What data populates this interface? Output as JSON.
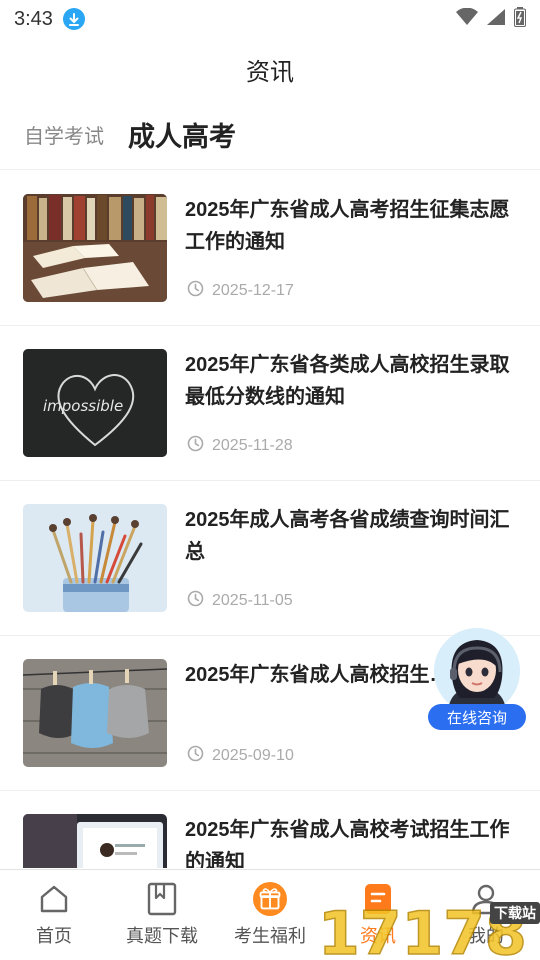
{
  "status": {
    "time": "3:43"
  },
  "header": {
    "title": "资讯"
  },
  "tabs": [
    {
      "label": "自学考试"
    },
    {
      "label": "成人高考"
    }
  ],
  "news": [
    {
      "title": "2025年广东省成人高考招生征集志愿工作的通知",
      "date": "2025-12-17",
      "image": "books-on-table"
    },
    {
      "title": "2025年广东省各类成人高校招生录取最低分数线的通知",
      "date": "2025-11-28",
      "image": "chalkboard-heart-impossible"
    },
    {
      "title": "2025年成人高考各省成绩查询时间汇总",
      "date": "2025-11-05",
      "image": "paint-brushes-in-jar"
    },
    {
      "title": "2025年广东省成人高校招生…布",
      "date": "2025-09-10",
      "image": "masks-on-clothesline"
    },
    {
      "title": "2025年广东省成人高校考试招生工作的通知",
      "date": "",
      "image": "laptop-on-desk"
    }
  ],
  "float": {
    "label": "在线咨询"
  },
  "nav": [
    {
      "label": "首页",
      "icon": "home-icon"
    },
    {
      "label": "真题下载",
      "icon": "book-icon"
    },
    {
      "label": "考生福利",
      "icon": "gift-icon"
    },
    {
      "label": "资讯",
      "icon": "news-icon",
      "active": true
    },
    {
      "label": "我的",
      "icon": "user-icon"
    }
  ],
  "watermark": {
    "text": "下载站",
    "digits": "17178"
  },
  "colors": {
    "accent": "#ff7a1a",
    "badge": "#2b6ef0",
    "download": "#2aa6f5"
  }
}
